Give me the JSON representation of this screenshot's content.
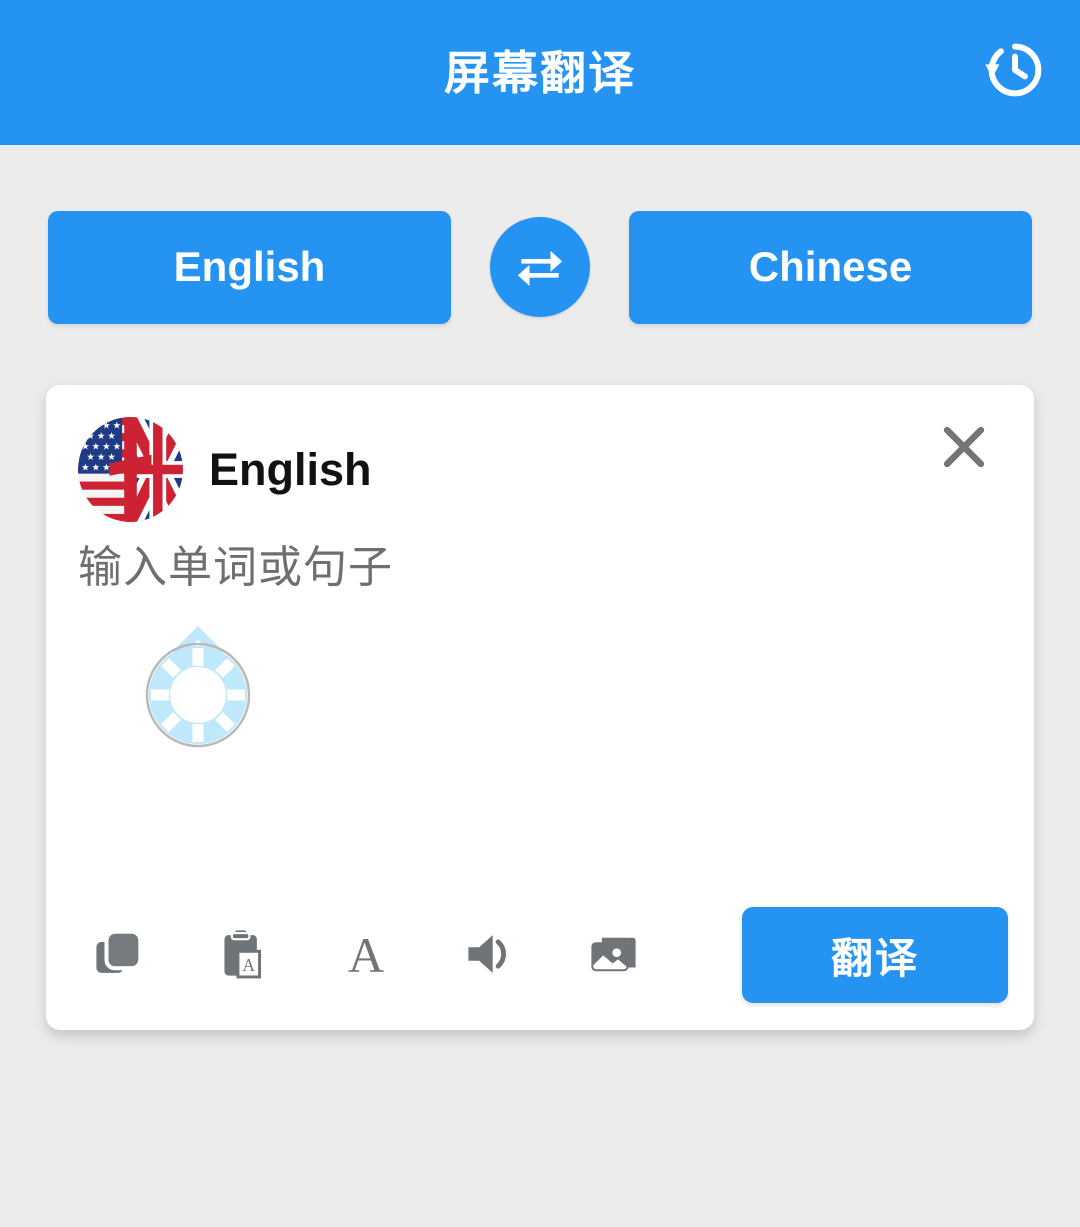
{
  "header": {
    "title": "屏幕翻译",
    "history_icon": "history-icon",
    "background_color": "#2593f2",
    "title_color": "#ffffff"
  },
  "language_bar": {
    "source_language": "English",
    "target_language": "Chinese",
    "swap_icon": "swap-horizontal-icon",
    "button_color": "#2593f2"
  },
  "card": {
    "flag_icon": "us-uk-flag-icon",
    "language_label": "English",
    "close_icon": "close-icon",
    "input": {
      "value": "",
      "placeholder": "输入单词或句子"
    },
    "cursor_indicator": "touch-cursor-indicator",
    "toolbar": [
      {
        "name": "copy-icon",
        "label": "Copy"
      },
      {
        "name": "paste-clipboard-icon",
        "label": "Paste"
      },
      {
        "name": "text-format-icon",
        "label": "A"
      },
      {
        "name": "speaker-icon",
        "label": "Speak"
      },
      {
        "name": "image-gallery-icon",
        "label": "Image"
      }
    ],
    "translate_label": "翻译",
    "translate_color": "#2593f2"
  },
  "page": {
    "background_color": "#ececec",
    "card_background": "#ffffff"
  }
}
